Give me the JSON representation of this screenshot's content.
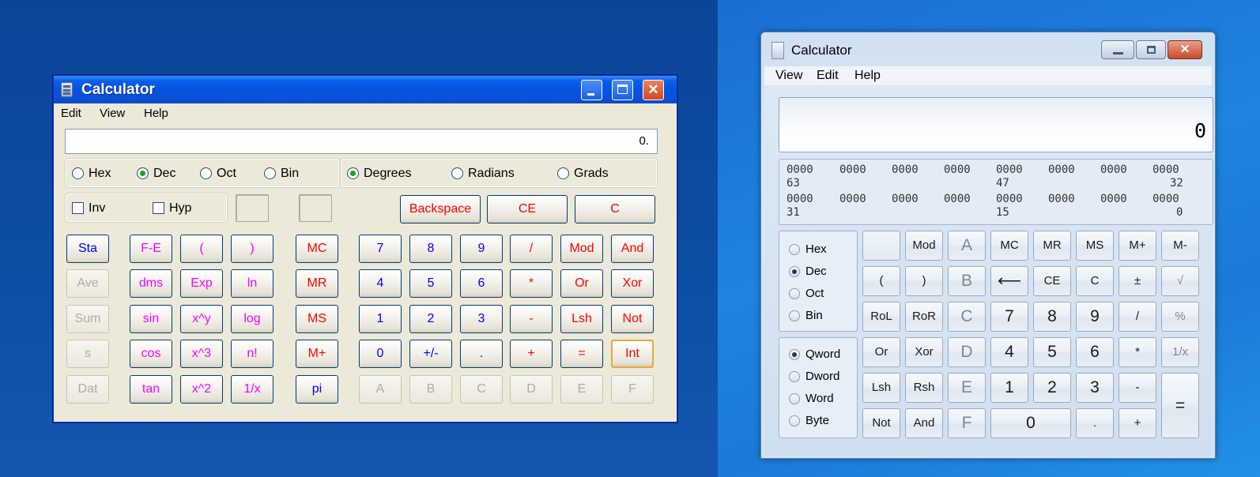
{
  "xp": {
    "title": "Calculator",
    "menu": [
      "Edit",
      "View",
      "Help"
    ],
    "display": "0.",
    "bases": [
      {
        "label": "Hex",
        "selected": false
      },
      {
        "label": "Dec",
        "selected": true
      },
      {
        "label": "Oct",
        "selected": false
      },
      {
        "label": "Bin",
        "selected": false
      }
    ],
    "angles": [
      {
        "label": "Degrees",
        "selected": true
      },
      {
        "label": "Radians",
        "selected": false
      },
      {
        "label": "Grads",
        "selected": false
      }
    ],
    "checks": [
      {
        "label": "Inv",
        "checked": false
      },
      {
        "label": "Hyp",
        "checked": false
      }
    ],
    "edit_buttons": [
      "Backspace",
      "CE",
      "C"
    ],
    "stat_buttons": [
      "Sta",
      "Ave",
      "Sum",
      "s",
      "Dat"
    ],
    "func_grid": [
      [
        "F-E",
        "(",
        ")"
      ],
      [
        "dms",
        "Exp",
        "ln"
      ],
      [
        "sin",
        "x^y",
        "log"
      ],
      [
        "cos",
        "x^3",
        "n!"
      ],
      [
        "tan",
        "x^2",
        "1/x"
      ]
    ],
    "mem_buttons": [
      "MC",
      "MR",
      "MS",
      "M+",
      "pi"
    ],
    "num_grid": [
      [
        "7",
        "8",
        "9",
        "/",
        "Mod",
        "And"
      ],
      [
        "4",
        "5",
        "6",
        "*",
        "Or",
        "Xor"
      ],
      [
        "1",
        "2",
        "3",
        "-",
        "Lsh",
        "Not"
      ],
      [
        "0",
        "+/-",
        ".",
        "+",
        "=",
        "Int"
      ],
      [
        "A",
        "B",
        "C",
        "D",
        "E",
        "F"
      ]
    ],
    "colors": {
      "titlebar": "#0553e1",
      "digit": "#0000ff",
      "operator": "#ff0000",
      "function": "#ff00ff"
    }
  },
  "w7": {
    "title": "Calculator",
    "menu": [
      "View",
      "Edit",
      "Help"
    ],
    "display": "0",
    "bits_row1": [
      "0000",
      "0000",
      "0000",
      "0000",
      "0000",
      "0000",
      "0000",
      "0000"
    ],
    "bits_row1_labels": [
      "63",
      "47",
      "32"
    ],
    "bits_row2": [
      "0000",
      "0000",
      "0000",
      "0000",
      "0000",
      "0000",
      "0000",
      "0000"
    ],
    "bits_row2_labels": [
      "31",
      "15",
      "0"
    ],
    "bases": [
      {
        "label": "Hex",
        "selected": false
      },
      {
        "label": "Dec",
        "selected": true
      },
      {
        "label": "Oct",
        "selected": false
      },
      {
        "label": "Bin",
        "selected": false
      }
    ],
    "word_sizes": [
      {
        "label": "Qword",
        "selected": true
      },
      {
        "label": "Dword",
        "selected": false
      },
      {
        "label": "Word",
        "selected": false
      },
      {
        "label": "Byte",
        "selected": false
      }
    ],
    "col1": [
      "",
      "(",
      "RoL",
      "Or",
      "Lsh",
      "Not"
    ],
    "col2": [
      "Mod",
      ")",
      "RoR",
      "Xor",
      "Rsh",
      "And"
    ],
    "hex_col": [
      "A",
      "B",
      "C",
      "D",
      "E",
      "F"
    ],
    "row1": [
      "MC",
      "MR",
      "MS",
      "M+",
      "M-"
    ],
    "row2": [
      "⟵",
      "CE",
      "C",
      "±",
      "√"
    ],
    "row3": [
      "7",
      "8",
      "9",
      "/",
      "%"
    ],
    "row4": [
      "4",
      "5",
      "6",
      "*",
      "1/x"
    ],
    "row5": [
      "1",
      "2",
      "3",
      "-"
    ],
    "row6": [
      "0",
      ".",
      "+"
    ],
    "equals": "="
  }
}
